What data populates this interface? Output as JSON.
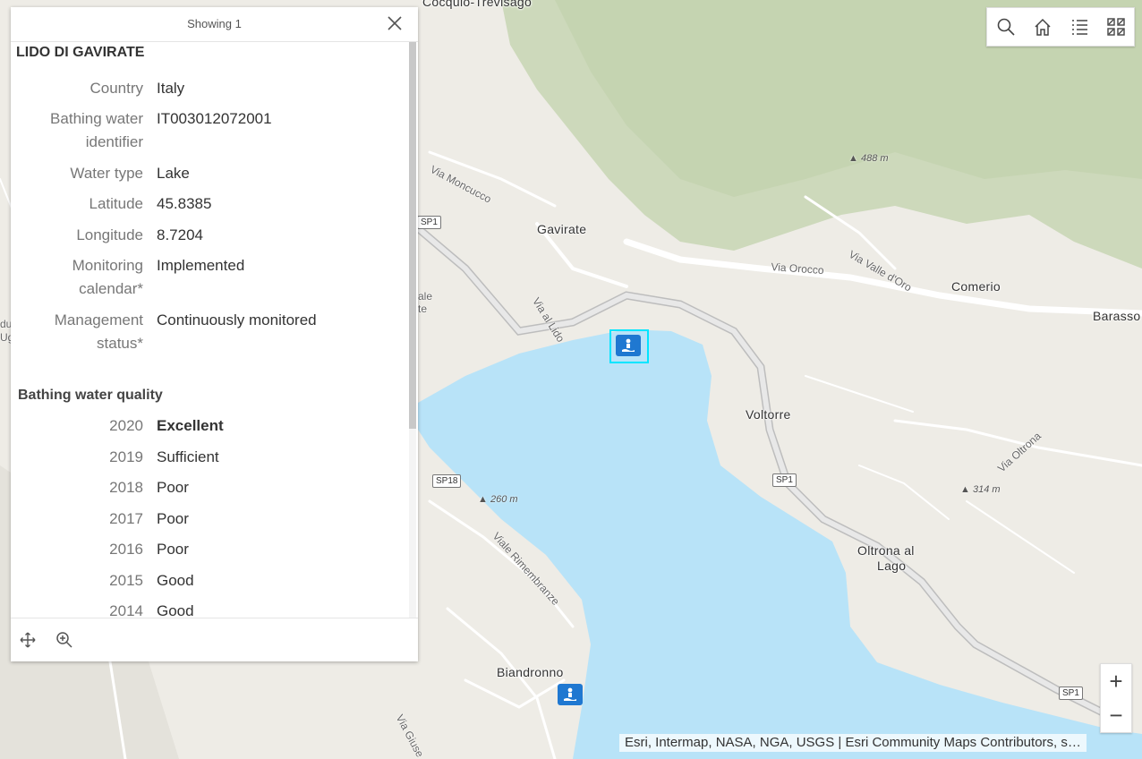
{
  "popup": {
    "count_label": "Showing 1",
    "title": "LIDO DI GAVIRATE",
    "fields": [
      {
        "label": "Country",
        "value": "Italy"
      },
      {
        "label": "Bathing water identifier",
        "value": "IT003012072001"
      },
      {
        "label": "Water type",
        "value": "Lake"
      },
      {
        "label": "Latitude",
        "value": "45.8385"
      },
      {
        "label": "Longitude",
        "value": "8.7204"
      },
      {
        "label": "Monitoring calendar*",
        "value": "Implemented"
      },
      {
        "label": "Management status*",
        "value": "Continuously monitored"
      }
    ],
    "quality_title": "Bathing water quality",
    "quality": [
      {
        "year": "2020",
        "value": "Excellent"
      },
      {
        "year": "2019",
        "value": "Sufficient"
      },
      {
        "year": "2018",
        "value": "Poor"
      },
      {
        "year": "2017",
        "value": "Poor"
      },
      {
        "year": "2016",
        "value": "Poor"
      },
      {
        "year": "2015",
        "value": "Good"
      },
      {
        "year": "2014",
        "value": "Good"
      }
    ],
    "footer_icons": [
      "move-icon",
      "zoom-to-icon"
    ]
  },
  "toolbar": {
    "icons": [
      "search-icon",
      "home-icon",
      "legend-list-icon",
      "basemap-gallery-icon"
    ]
  },
  "zoom": {
    "in_label": "+",
    "out_label": "−"
  },
  "attribution": "Esri, Intermap, NASA, NGA, USGS | Esri Community Maps Contributors, s…",
  "map": {
    "places": [
      "Cocquio-Trevisago",
      "Gavirate",
      "Comerio",
      "Barasso",
      "Voltorre",
      "Oltrona al",
      "Lago",
      "Biandronno"
    ],
    "roads": [
      "Via Moncucco",
      "Via al Lido",
      "Via Orocco",
      "Via Valle d'Oro",
      "Viale Rimembranze",
      "Via Oltrona",
      "Via Giuse"
    ],
    "elevations": [
      "488 m",
      "260 m",
      "314 m"
    ],
    "shields": [
      "SP1",
      "SP18",
      "SP1",
      "SP1"
    ],
    "edge_fragments": [
      "ale",
      "te",
      "du",
      "Ug"
    ],
    "colors": {
      "water": "#b8e3f8",
      "land": "#eeece6",
      "hills": "#c9d7b6",
      "roads": "#ffffff",
      "selection": "#00e5ff",
      "beach_icon": "#1f78d1"
    }
  }
}
